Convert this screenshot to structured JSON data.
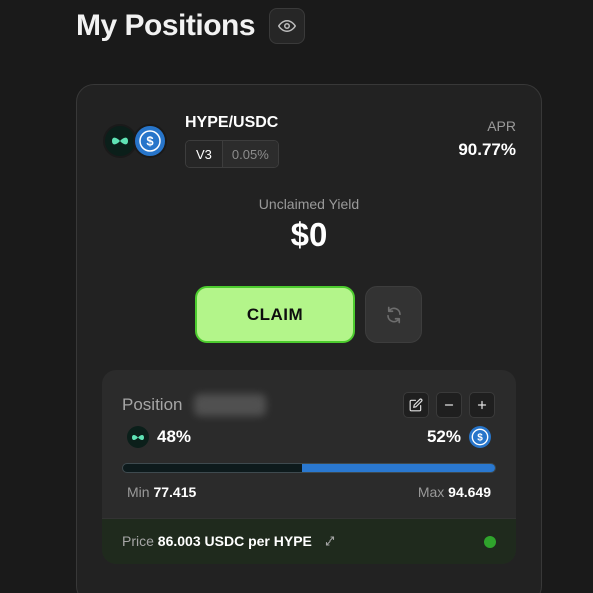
{
  "header": {
    "title": "My Positions"
  },
  "card": {
    "pair": "HYPE/USDC",
    "tokens": [
      "HYPE",
      "USDC"
    ],
    "version": "V3",
    "fee": "0.05%",
    "apr_label": "APR",
    "apr_value": "90.77%",
    "yield_label": "Unclaimed Yield",
    "yield_value": "$0",
    "claim_label": "CLAIM"
  },
  "position": {
    "label": "Position",
    "left_pct": "48%",
    "right_pct": "52%",
    "composition": {
      "HYPE": 0.48,
      "USDC": 0.52
    },
    "min_label": "Min",
    "min_value": "77.415",
    "max_label": "Max",
    "max_value": "94.649",
    "price_label": "Price",
    "price_value": "86.003",
    "price_unit": "USDC per HYPE"
  },
  "icons": [
    "eye-icon",
    "hype-token-icon",
    "usdc-token-icon",
    "refresh-icon",
    "edit-icon",
    "minus-icon",
    "plus-icon",
    "swap-icon",
    "status-dot"
  ],
  "colors": {
    "accent_green": "#b3f58a",
    "claim_border": "#4ccc2e",
    "usdc_blue": "#2775ca",
    "bar_blue": "#2a78d0",
    "status_green": "#2fa32c",
    "hype_teal": "#5fe3b5"
  }
}
